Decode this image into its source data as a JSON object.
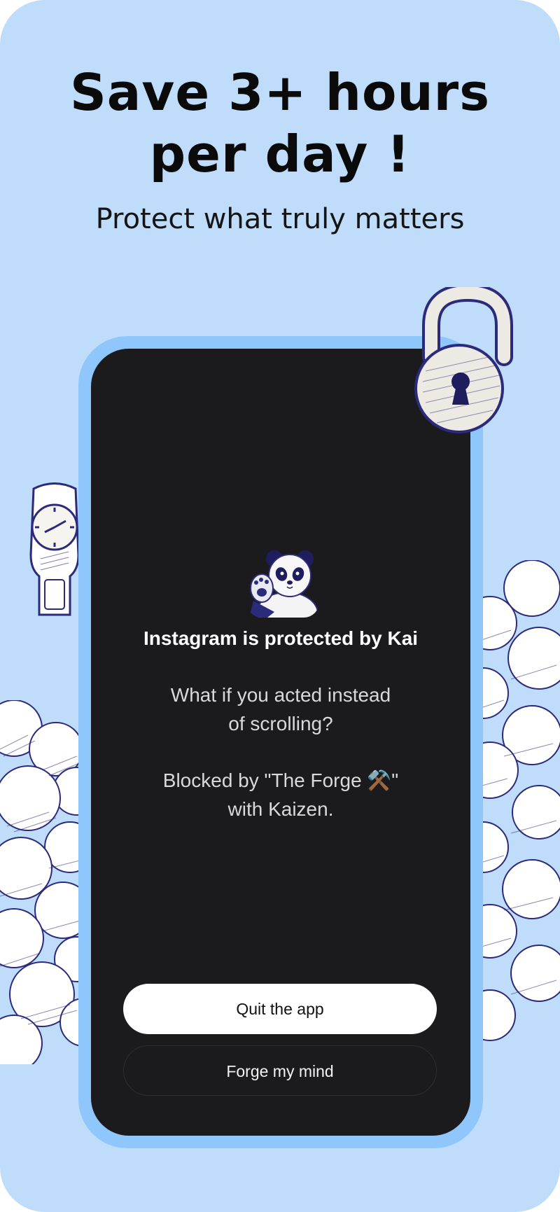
{
  "headline": {
    "line1": "Save 3+ hours",
    "line2": "per day !"
  },
  "subtitle": "Protect what truly matters",
  "blocked_screen": {
    "title": "Instagram is protected by Kai",
    "message_line1": "What if you acted instead",
    "message_line2": "of scrolling?",
    "blocked_line1": "Blocked by \"The Forge ⚒️\"",
    "blocked_line2": "with Kaizen.",
    "quit_button": "Quit the app",
    "forge_button": "Forge my mind"
  },
  "colors": {
    "background": "#bfdcfb",
    "phone_frame": "#8fc6fb",
    "phone_screen": "#1b1b1e",
    "ink": "#2c2a7a"
  },
  "icons": [
    "padlock-icon",
    "clock-icon",
    "panda-avatar",
    "cloud-illustration"
  ]
}
